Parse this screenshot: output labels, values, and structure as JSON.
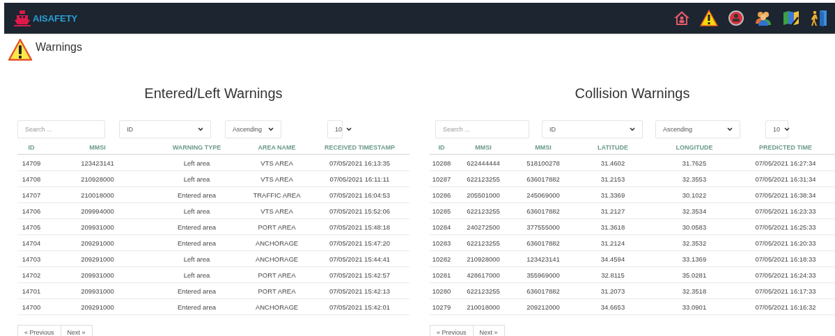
{
  "navbar": {
    "brand": "AISAFETY"
  },
  "page_header": {
    "title": "Warnings"
  },
  "panels": [
    {
      "title": "Entered/Left Warnings",
      "search": {
        "placeholder": "Search ..."
      },
      "sort_field": "ID",
      "sort_order": "Ascending",
      "page_size": "10",
      "columns": [
        "ID",
        "MMSI",
        "WARNING TYPE",
        "AREA NAME",
        "RECEIVED TIMESTAMP"
      ],
      "rows": [
        [
          "14709",
          "123423141",
          "Left area",
          "VTS AREA",
          "07/05/2021 16:13:35"
        ],
        [
          "14708",
          "210928000",
          "Left area",
          "VTS AREA",
          "07/05/2021 16:11:11"
        ],
        [
          "14707",
          "210018000",
          "Entered area",
          "TRAFFIC AREA",
          "07/05/2021 16:04:53"
        ],
        [
          "14706",
          "209994000",
          "Left area",
          "VTS AREA",
          "07/05/2021 15:52:06"
        ],
        [
          "14705",
          "209931000",
          "Entered area",
          "PORT AREA",
          "07/05/2021 15:48:18"
        ],
        [
          "14704",
          "209291000",
          "Entered area",
          "ANCHORAGE",
          "07/05/2021 15:47:20"
        ],
        [
          "14703",
          "209291000",
          "Left area",
          "ANCHORAGE",
          "07/05/2021 15:44:41"
        ],
        [
          "14702",
          "209931000",
          "Left area",
          "PORT AREA",
          "07/05/2021 15:42:57"
        ],
        [
          "14701",
          "209931000",
          "Entered area",
          "PORT AREA",
          "07/05/2021 15:42:13"
        ],
        [
          "14700",
          "209291000",
          "Entered area",
          "ANCHORAGE",
          "07/05/2021 15:42:01"
        ]
      ],
      "pagination": [
        "« Previous",
        "Next »"
      ]
    },
    {
      "title": "Collision Warnings",
      "search": {
        "placeholder": "Search ..."
      },
      "sort_field": "ID",
      "sort_order": "Ascending",
      "page_size": "10",
      "columns": [
        "ID",
        "MMSI",
        "MMSI",
        "LATITUDE",
        "LONGITUDE",
        "PREDICTED TIME"
      ],
      "rows": [
        [
          "10288",
          "622444444",
          "518100278",
          "31.4602",
          "31.7625",
          "07/05/2021 16:27:34"
        ],
        [
          "10287",
          "622123255",
          "636017882",
          "31.2153",
          "32.3553",
          "07/05/2021 16:31:34"
        ],
        [
          "10286",
          "205501000",
          "245069000",
          "31.3369",
          "30.1022",
          "07/05/2021 16:38:34"
        ],
        [
          "10285",
          "622123255",
          "636017882",
          "31.2127",
          "32.3534",
          "07/05/2021 16:23:33"
        ],
        [
          "10284",
          "240272500",
          "377555000",
          "31.3618",
          "30.0583",
          "07/05/2021 16:25:33"
        ],
        [
          "10283",
          "622123255",
          "636017882",
          "31.2124",
          "32.3532",
          "07/05/2021 16:20:33"
        ],
        [
          "10282",
          "210928000",
          "123423141",
          "34.4594",
          "33.1369",
          "07/05/2021 16:18:33"
        ],
        [
          "10281",
          "428617000",
          "355969000",
          "32.8115",
          "35.0281",
          "07/05/2021 16:24:33"
        ],
        [
          "10280",
          "622123255",
          "636017882",
          "31.2073",
          "32.3518",
          "07/05/2021 16:17:33"
        ],
        [
          "10279",
          "210018000",
          "209212000",
          "34.6653",
          "33.0901",
          "07/05/2021 16:16:32"
        ]
      ],
      "pagination": [
        "« Previous",
        "Next »"
      ]
    }
  ]
}
